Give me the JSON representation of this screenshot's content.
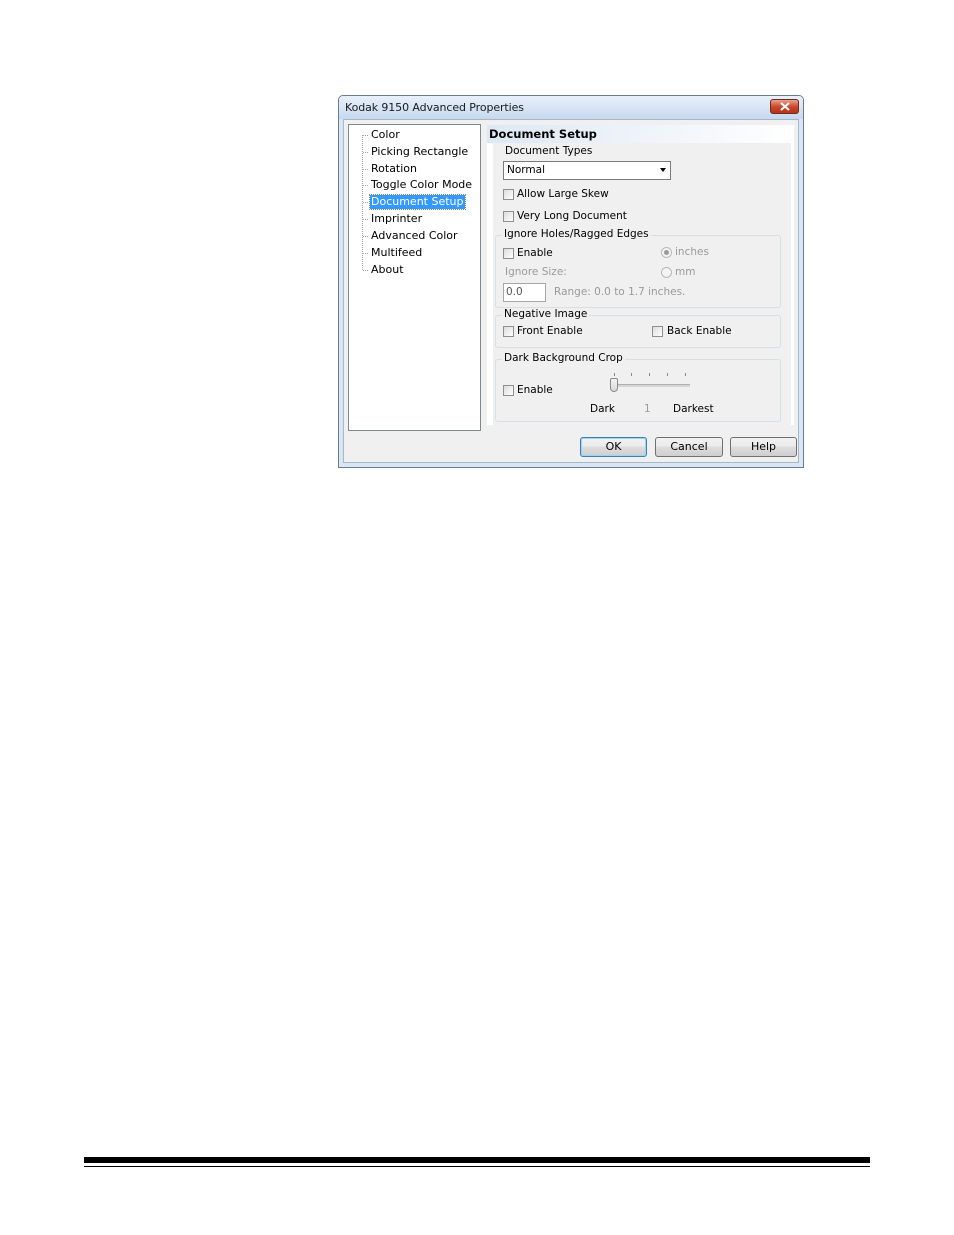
{
  "window": {
    "title": "Kodak 9150 Advanced Properties",
    "close_icon": "close-icon"
  },
  "tree": {
    "items": [
      {
        "label": "Color"
      },
      {
        "label": "Picking Rectangle"
      },
      {
        "label": "Rotation"
      },
      {
        "label": "Toggle Color Mode"
      },
      {
        "label": "Document Setup",
        "selected": true
      },
      {
        "label": "Imprinter"
      },
      {
        "label": "Advanced Color"
      },
      {
        "label": "Multifeed"
      },
      {
        "label": "About"
      }
    ]
  },
  "panel": {
    "header": "Document Setup",
    "document_types": {
      "label": "Document Types",
      "value": "Normal"
    },
    "allow_large_skew": {
      "label": "Allow Large Skew",
      "checked": false
    },
    "very_long_document": {
      "label": "Very Long Document",
      "checked": false
    },
    "ignore_holes": {
      "title": "Ignore Holes/Ragged Edges",
      "enable_label": "Enable",
      "inches_label": "inches",
      "mm_label": "mm",
      "ignore_size_label": "Ignore Size:",
      "size_value": "0.0",
      "range_text": "Range: 0.0 to 1.7 inches."
    },
    "negative_image": {
      "title": "Negative Image",
      "front_label": "Front Enable",
      "back_label": "Back Enable"
    },
    "dark_background_crop": {
      "title": "Dark Background Crop",
      "enable_label": "Enable",
      "min_label": "Dark",
      "value": "1",
      "max_label": "Darkest",
      "slider_level": 1
    }
  },
  "buttons": {
    "ok": "OK",
    "cancel": "Cancel",
    "help": "Help"
  },
  "colors": {
    "selection": "#3399ff",
    "close_button": "#c8452a"
  }
}
